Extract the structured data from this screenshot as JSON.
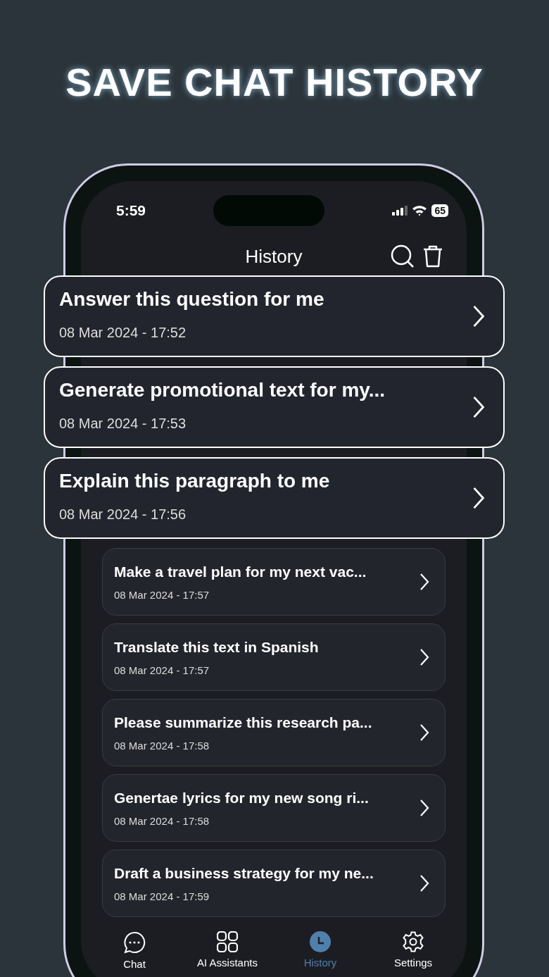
{
  "headline": "SAVE CHAT HISTORY",
  "status_bar": {
    "time": "5:59",
    "battery": "65"
  },
  "header": {
    "title": "History"
  },
  "chats": [
    {
      "title": "Answer this question for me",
      "date": "08 Mar 2024 - 17:52",
      "highlighted": true
    },
    {
      "title": "Generate promotional text for my...",
      "date": "08 Mar 2024 - 17:53",
      "highlighted": true
    },
    {
      "title": "Explain this paragraph to me",
      "date": "08 Mar 2024 - 17:56",
      "highlighted": true
    },
    {
      "title": "Make a travel plan for my next vac...",
      "date": "08 Mar 2024 - 17:57",
      "highlighted": false
    },
    {
      "title": "Translate this text in Spanish",
      "date": "08 Mar 2024 - 17:57",
      "highlighted": false
    },
    {
      "title": "Please summarize this research pa...",
      "date": "08 Mar 2024 - 17:58",
      "highlighted": false
    },
    {
      "title": "Genertae lyrics for my new song ri...",
      "date": "08 Mar 2024 - 17:58",
      "highlighted": false
    },
    {
      "title": "Draft a business strategy for my ne...",
      "date": "08 Mar 2024 - 17:59",
      "highlighted": false
    }
  ],
  "tabs": [
    {
      "label": "Chat",
      "kind": "chat",
      "selected": false
    },
    {
      "label": "AI Assistants",
      "kind": "grid",
      "selected": false
    },
    {
      "label": "History",
      "kind": "clock",
      "selected": true
    },
    {
      "label": "Settings",
      "kind": "gear",
      "selected": false
    }
  ]
}
